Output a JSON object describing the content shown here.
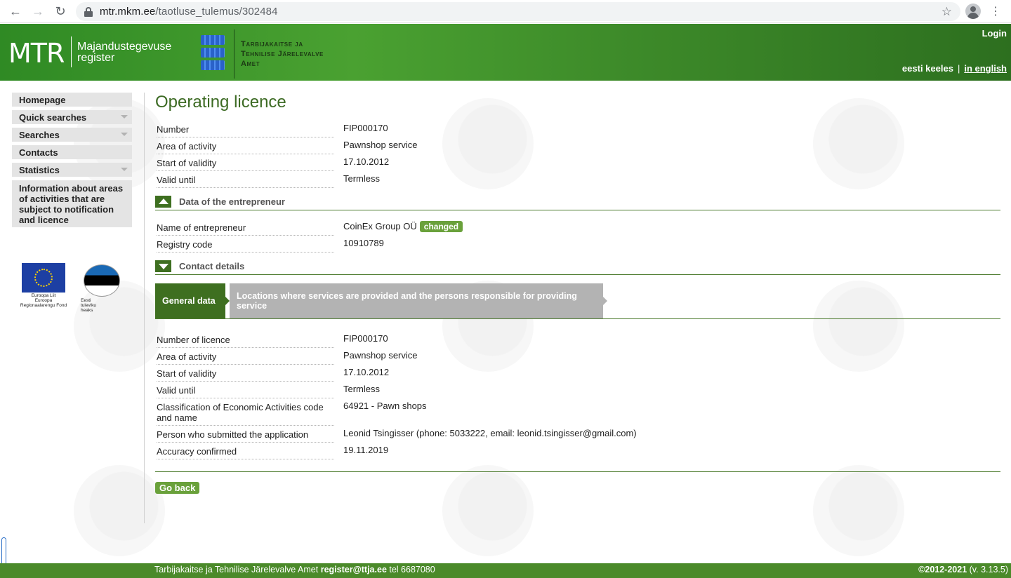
{
  "browser": {
    "url_host": "mtr.mkm.ee",
    "url_path": "/taotluse_tulemus/302484"
  },
  "header": {
    "logo": "MTR",
    "logo_sub_1": "Majandustegevuse",
    "logo_sub_2": "register",
    "agency_1": "Tarbijakaitse ja",
    "agency_2": "Tehnilise Järelevalve",
    "agency_3": "Amet",
    "login": "Login",
    "lang_et": "eesti keeles",
    "lang_sep": "|",
    "lang_en": "in english"
  },
  "sidebar": {
    "items": [
      {
        "label": "Homepage"
      },
      {
        "label": "Quick searches"
      },
      {
        "label": "Searches"
      },
      {
        "label": "Contacts"
      },
      {
        "label": "Statistics"
      },
      {
        "label": "Information about areas of activities that are subject to notification and licence"
      }
    ],
    "eu_text_1": "Euroopa Liit",
    "eu_text_2": "Euroopa",
    "eu_text_3": "Regionaalarengu Fond",
    "eest_text": "Eesti tuleviku heaks"
  },
  "main": {
    "title": "Operating licence",
    "licence": [
      {
        "label": "Number",
        "value": "FIP000170"
      },
      {
        "label": "Area of activity",
        "value": "Pawnshop service"
      },
      {
        "label": "Start of validity",
        "value": "17.10.2012"
      },
      {
        "label": "Valid until",
        "value": "Termless"
      }
    ],
    "entrepreneur_section": "Data of the entrepreneur",
    "entrepreneur": {
      "name_label": "Name of entrepreneur",
      "name_value": "CoinEx Group OÜ",
      "badge": "changed",
      "code_label": "Registry code",
      "code_value": "10910789"
    },
    "contact_section": "Contact details",
    "tabs": {
      "active": "General data",
      "inactive": "Locations where services are provided and the persons responsible for providing service"
    },
    "general": [
      {
        "label": "Number of licence",
        "value": "FIP000170"
      },
      {
        "label": "Area of activity",
        "value": "Pawnshop service"
      },
      {
        "label": "Start of validity",
        "value": "17.10.2012"
      },
      {
        "label": "Valid until",
        "value": "Termless"
      },
      {
        "label": "Classification of Economic Activities code and name",
        "value": "64921 - Pawn shops"
      },
      {
        "label": "Person who submitted the application",
        "value": "Leonid Tsingisser (phone: 5033222, email: leonid.tsingisser@gmail.com)"
      },
      {
        "label": "Accuracy confirmed",
        "value": "19.11.2019"
      }
    ],
    "go_back": "Go back"
  },
  "footer": {
    "agency": "Tarbijakaitse ja Tehnilise Järelevalve Amet",
    "email": "register@ttja.ee",
    "phone": "tel 6687080",
    "copyright": "©2012-2021",
    "version": "(v. 3.13.5)"
  }
}
